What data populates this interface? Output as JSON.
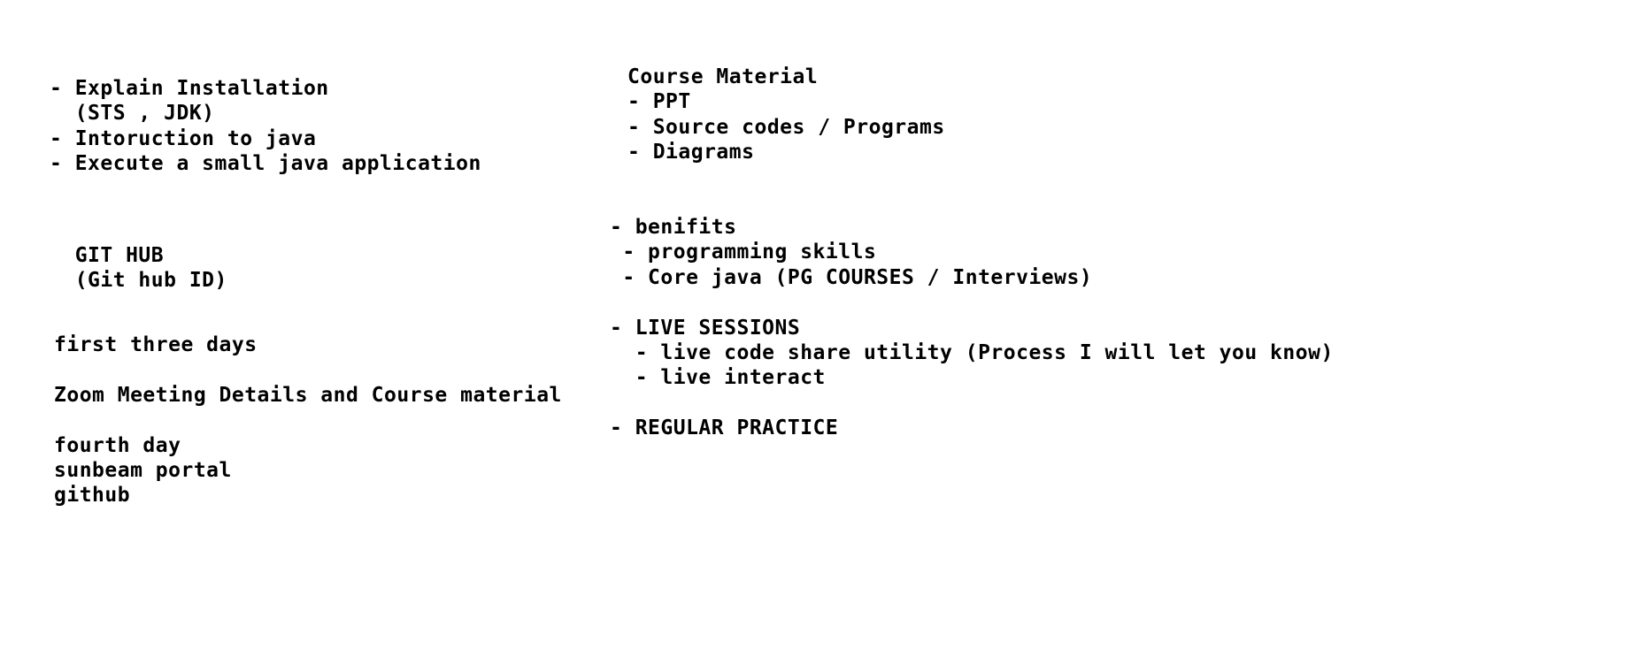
{
  "notes": {
    "left_top": [
      "- Explain Installation",
      "  (STS , JDK)",
      "- Intoruction to java",
      "- Execute a small java application"
    ],
    "git_hub": [
      "  GIT HUB",
      "  (Git hub ID)"
    ],
    "schedule": [
      "first three days",
      "",
      "Zoom Meeting Details and Course material",
      "",
      "fourth day",
      "sunbeam portal",
      "github"
    ],
    "course_material": [
      "Course Material",
      "- PPT",
      "- Source codes / Programs",
      "- Diagrams"
    ],
    "benefits": [
      "- benifits",
      " - programming skills",
      " - Core java (PG COURSES / Interviews)",
      "",
      "- LIVE SESSIONS",
      "  - live code share utility (Process I will let you know)",
      "  - live interact",
      "",
      "- REGULAR PRACTICE"
    ]
  }
}
